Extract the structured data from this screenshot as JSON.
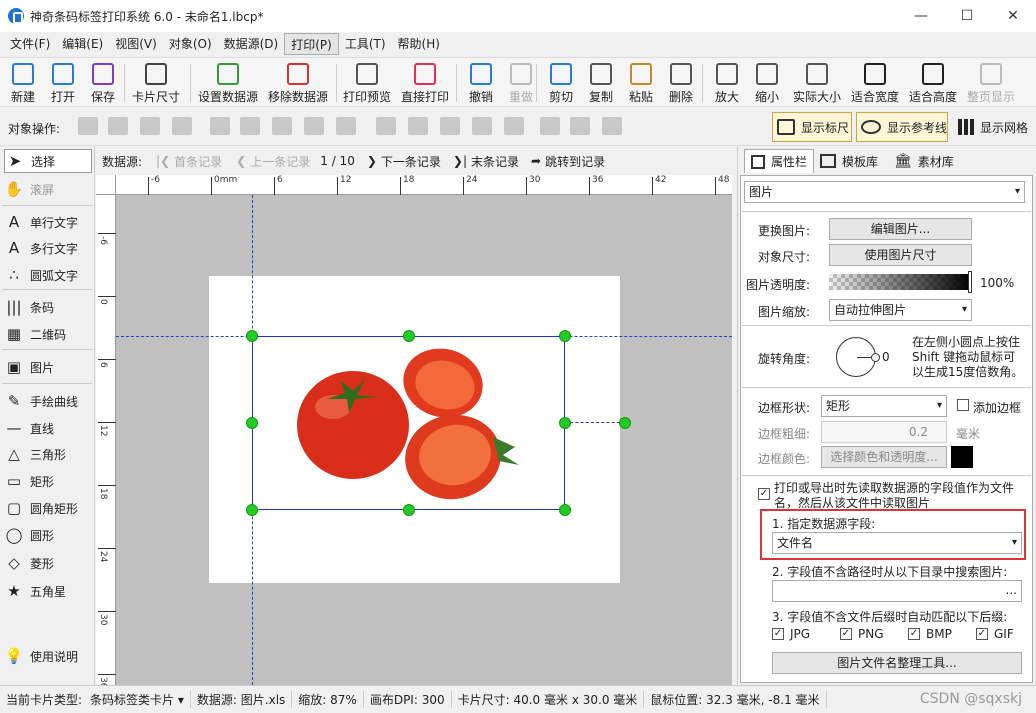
{
  "window": {
    "title": "神奇条码标签打印系统 6.0 - 未命名1.lbcp*"
  },
  "menu": [
    "文件(F)",
    "编辑(E)",
    "视图(V)",
    "对象(O)",
    "数据源(D)",
    "打印(P)",
    "工具(T)",
    "帮助(H)"
  ],
  "menu_active": "打印(P)",
  "toolbar": [
    {
      "label": "新建",
      "icon": "new-file-icon",
      "color": "#2b7bd6"
    },
    {
      "label": "打开",
      "icon": "open-folder-icon",
      "color": "#2b7bd6"
    },
    {
      "label": "保存",
      "icon": "save-icon",
      "color": "#7b3fbf"
    },
    {
      "label": "卡片尺寸",
      "icon": "card-size-icon",
      "color": "#444444"
    },
    {
      "label": "设置数据源",
      "icon": "database-set-icon",
      "color": "#3a9a3a"
    },
    {
      "label": "移除数据源",
      "icon": "database-remove-icon",
      "color": "#d33333"
    },
    {
      "label": "打印预览",
      "icon": "print-preview-icon",
      "color": "#555555"
    },
    {
      "label": "直接打印",
      "icon": "printer-icon",
      "color": "#e0305a"
    },
    {
      "label": "撤销",
      "icon": "undo-icon",
      "color": "#2b7bd6"
    },
    {
      "label": "重做",
      "icon": "redo-icon",
      "color": "#bbbbbb",
      "disabled": true
    },
    {
      "label": "剪切",
      "icon": "scissors-icon",
      "color": "#2b7bd6"
    },
    {
      "label": "复制",
      "icon": "copy-icon",
      "color": "#555555"
    },
    {
      "label": "粘贴",
      "icon": "paste-icon",
      "color": "#c08a30"
    },
    {
      "label": "删除",
      "icon": "trash-icon",
      "color": "#555555"
    },
    {
      "label": "放大",
      "icon": "zoom-in-icon",
      "color": "#555555"
    },
    {
      "label": "缩小",
      "icon": "zoom-out-icon",
      "color": "#555555"
    },
    {
      "label": "实际大小",
      "icon": "actual-size-icon",
      "color": "#555555"
    },
    {
      "label": "适合宽度",
      "icon": "fit-width-icon",
      "color": "#222222"
    },
    {
      "label": "适合高度",
      "icon": "fit-height-icon",
      "color": "#222222"
    },
    {
      "label": "整页显示",
      "icon": "full-page-icon",
      "color": "#bbbbbb",
      "disabled": true
    }
  ],
  "objbar": {
    "label": "对象操作:",
    "show_ruler": "显示标尺",
    "show_guides": "显示参考线",
    "show_grid": "显示网格"
  },
  "tools": [
    {
      "label": "选择",
      "icon": "arrow-cursor-icon",
      "glyph": "➤"
    },
    {
      "label": "滚屏",
      "icon": "hand-icon",
      "glyph": "✋"
    },
    {
      "label": "单行文字",
      "icon": "single-line-text-icon",
      "glyph": "A"
    },
    {
      "label": "多行文字",
      "icon": "multi-line-text-icon",
      "glyph": "A"
    },
    {
      "label": "圆弧文字",
      "icon": "arc-text-icon",
      "glyph": "∴"
    },
    {
      "label": "条码",
      "icon": "barcode-icon",
      "glyph": "|||"
    },
    {
      "label": "二维码",
      "icon": "qrcode-icon",
      "glyph": "▦"
    },
    {
      "label": "图片",
      "icon": "image-icon",
      "glyph": "▣"
    },
    {
      "label": "手绘曲线",
      "icon": "pen-icon",
      "glyph": "✎"
    },
    {
      "label": "直线",
      "icon": "line-icon",
      "glyph": "—"
    },
    {
      "label": "三角形",
      "icon": "triangle-icon",
      "glyph": "△"
    },
    {
      "label": "矩形",
      "icon": "rectangle-icon",
      "glyph": "▭"
    },
    {
      "label": "圆角矩形",
      "icon": "rounded-rect-icon",
      "glyph": "▢"
    },
    {
      "label": "圆形",
      "icon": "ellipse-icon",
      "glyph": "◯"
    },
    {
      "label": "菱形",
      "icon": "diamond-icon",
      "glyph": "◇"
    },
    {
      "label": "五角星",
      "icon": "star-icon",
      "glyph": "★"
    },
    {
      "label": "使用说明",
      "icon": "lightbulb-icon",
      "glyph": "💡"
    }
  ],
  "databar": {
    "label": "数据源:",
    "first": "首条记录",
    "prev": "上一条记录",
    "page": "1 / 10",
    "next": "下一条记录",
    "last": "末条记录",
    "jump": "跳转到记录"
  },
  "ruler": {
    "h_ticks": [
      "-6",
      "0mm",
      "6",
      "12",
      "18",
      "24",
      "30",
      "36",
      "42",
      "48"
    ],
    "v_ticks": [
      "-6",
      "0",
      "6",
      "12",
      "18",
      "24",
      "30",
      "36"
    ]
  },
  "right": {
    "tabs": [
      "属性栏",
      "模板库",
      "素材库"
    ],
    "object_type": "图片",
    "change_image_label": "更换图片:",
    "edit_image_btn": "编辑图片...",
    "object_size_label": "对象尺寸:",
    "use_image_size_btn": "使用图片尺寸",
    "transparency_label": "图片透明度:",
    "transparency_value": "100%",
    "transparency_fraction": 1.0,
    "scale_label": "图片缩放:",
    "scale_value": "自动拉伸图片",
    "rotation_label": "旋转角度:",
    "rotation_value": "0",
    "rotation_hint": "在左侧小圆点上按住Shift 键拖动鼠标可以生成15度倍数角。",
    "border_shape_label": "边框形状:",
    "border_shape_value": "矩形",
    "add_border_label": "添加边框",
    "border_width_label": "边框粗细:",
    "border_width_value": "0.2",
    "border_width_unit": "毫米",
    "border_color_label": "边框颜色:",
    "border_color_btn": "选择颜色和透明度...",
    "border_color": "#000000",
    "read_from_datasource": "打印或导出时先读取数据源的字段值作为文件名，然后从该文件中读取图片",
    "step1_label": "1. 指定数据源字段:",
    "step1_value": "文件名",
    "step2_label": "2. 字段值不含路径时从以下目录中搜索图片:",
    "step2_btn": "...",
    "step3_label": "3. 字段值不含文件后缀时自动匹配以下后缀:",
    "ext": [
      "JPG",
      "PNG",
      "BMP",
      "GIF"
    ],
    "tool_btn": "图片文件名整理工具..."
  },
  "status": {
    "card_type": "当前卡片类型:",
    "card_type_value": "条码标签类卡片",
    "datasource": "数据源: 图片.xls",
    "zoom": "缩放: 87%",
    "dpi": "画布DPI: 300",
    "card_size": "卡片尺寸: 40.0 毫米 x 30.0 毫米",
    "mouse": "鼠标位置: 32.3 毫米, -8.1 毫米",
    "watermark": "CSDN @sqxskj"
  }
}
